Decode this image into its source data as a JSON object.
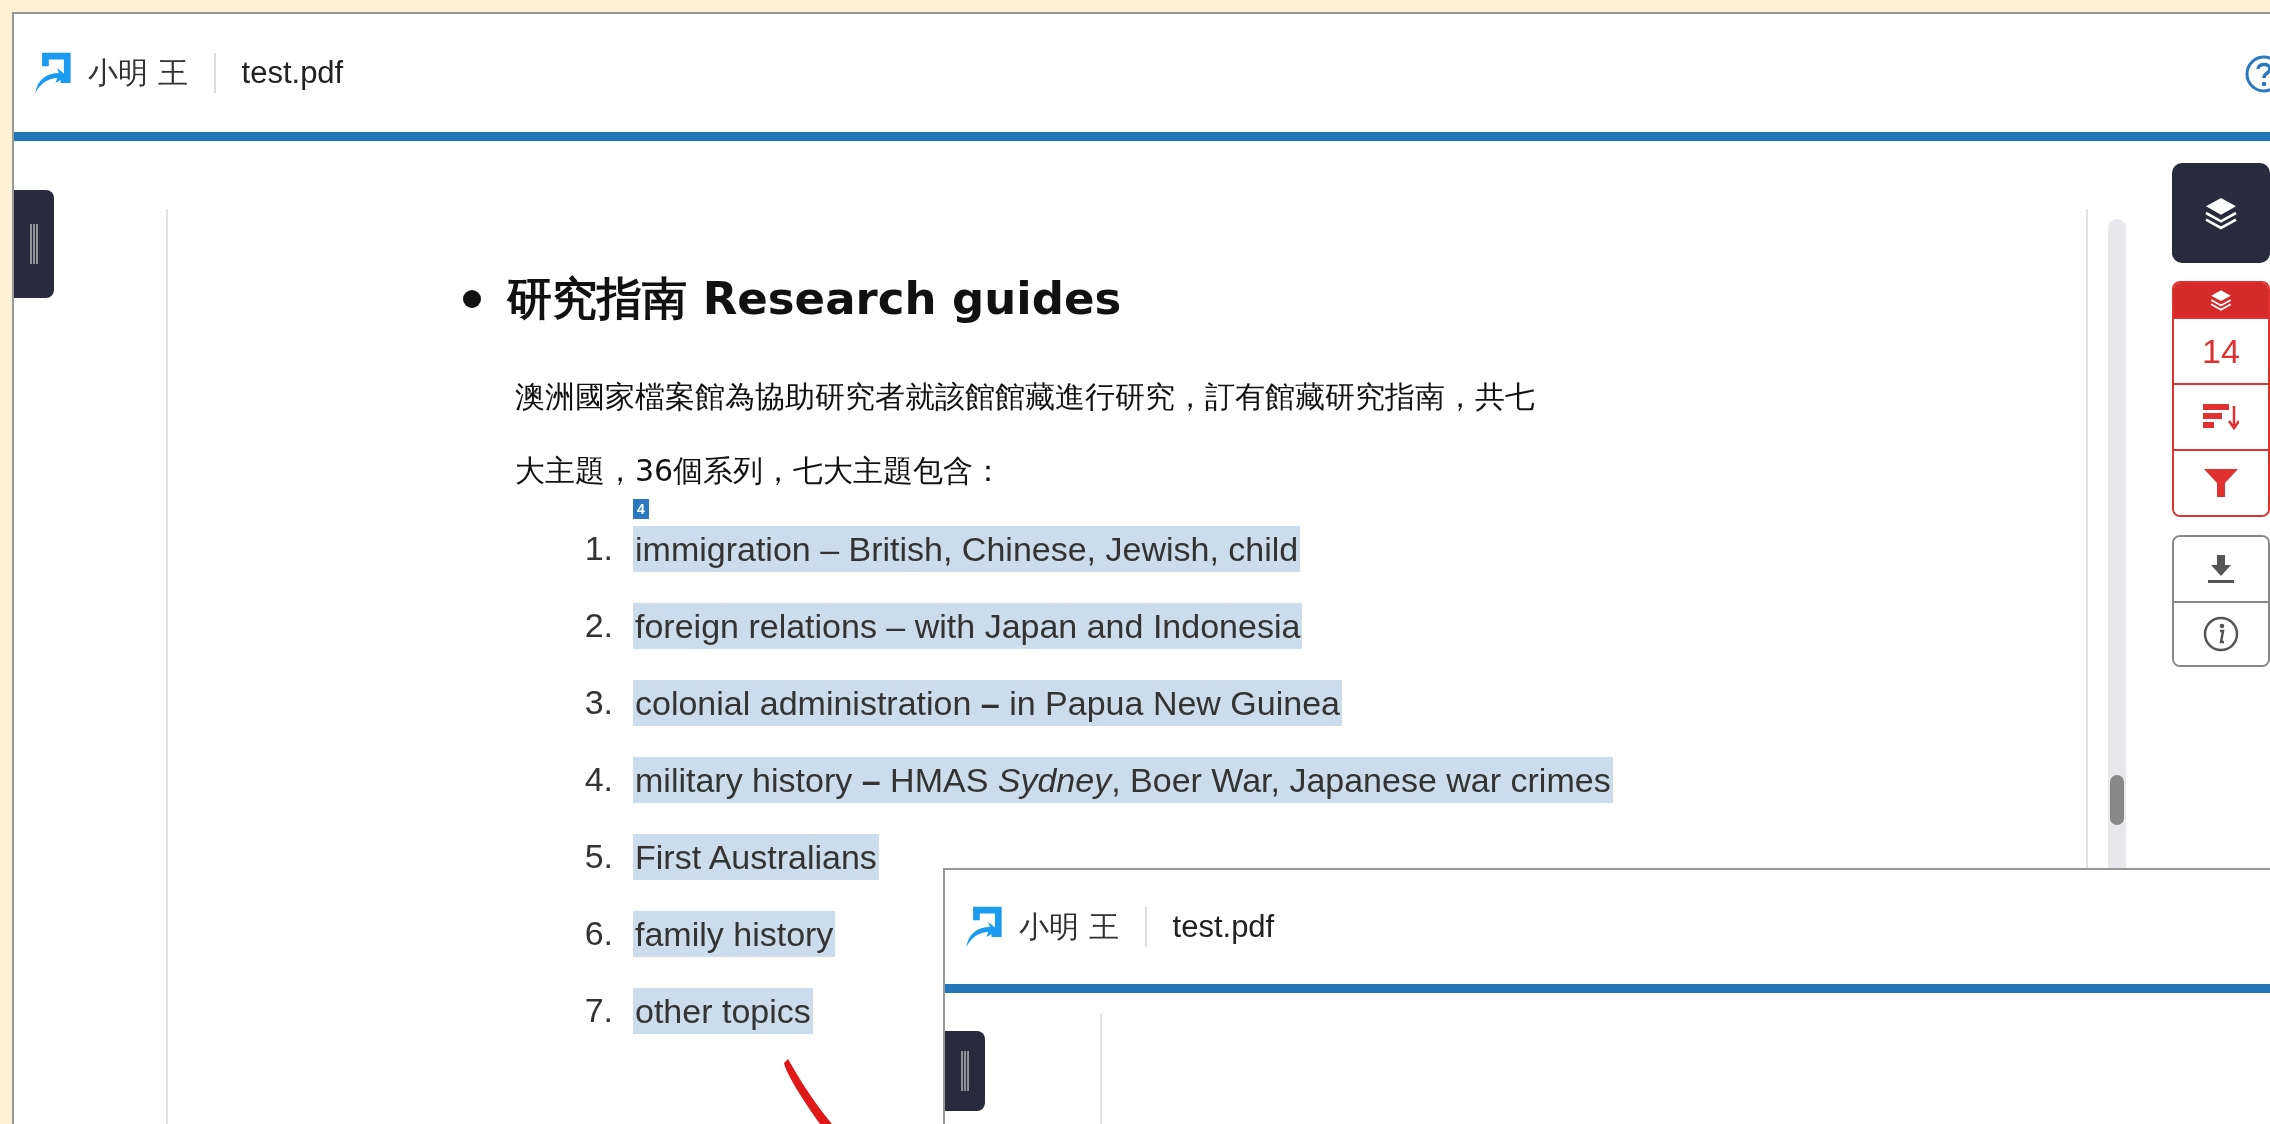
{
  "header": {
    "user": "小明 王",
    "filename": "test.pdf"
  },
  "document": {
    "heading": "研究指南 Research guides",
    "paragraph_lines": [
      "澳洲國家檔案館為協助研究者就該館館藏進行研究，訂有館藏研究指南，共七",
      "大主題，36個系列，七大主題包含："
    ],
    "badge": "4",
    "items": [
      {
        "number": "1.",
        "text": "immigration – British, Chinese, Jewish, child",
        "highlighted": true
      },
      {
        "number": "2.",
        "text": "foreign relations – with Japan and Indonesia",
        "highlighted": true
      },
      {
        "number": "3.",
        "text": "colonial administration **–** in Papua New Guinea",
        "highlighted": true
      },
      {
        "number": "4.",
        "text": "military history **–** HMAS *Sydney*, Boer War, Japanese war crimes",
        "highlighted": true
      },
      {
        "number": "5.",
        "text": "First Australians",
        "highlighted": true
      },
      {
        "number": "6.",
        "text": "family history",
        "highlighted": true
      },
      {
        "number": "7.",
        "text": "other topics",
        "highlighted": true
      }
    ]
  },
  "toolbar": {
    "layers_selected": true,
    "count": "14"
  },
  "overlay_window": {
    "user": "小明 王",
    "filename": "test.pdf"
  }
}
